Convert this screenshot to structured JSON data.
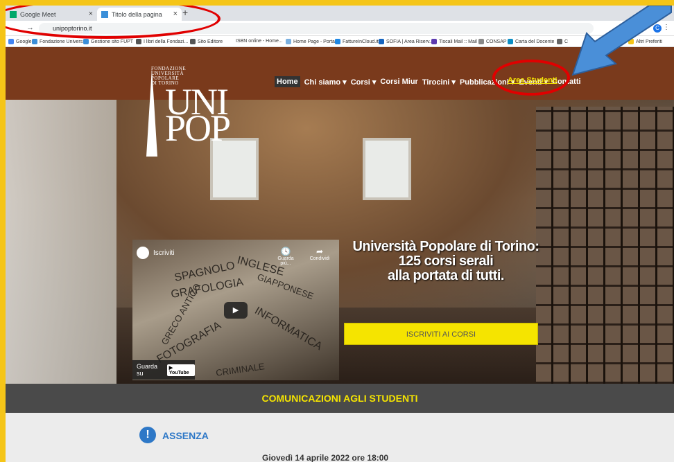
{
  "browser": {
    "tabs": [
      {
        "title": "Google Meet",
        "close": "×"
      },
      {
        "title": "Titolo della pagina",
        "close": "×"
      }
    ],
    "new_tab": "+",
    "window_controls": "—  ☐  ×",
    "nav_arrows": "← → C",
    "url": "unipoptorino.it",
    "profile_initial": "C",
    "bookmarks": [
      "Google",
      "Fondazione Univers...",
      "Gestione sito FUPT",
      "I libri della Fondazi...",
      "Sito Editore",
      "ISBN online - Home...",
      "Home Page - Portal...",
      "FattureInCloud.it",
      "SOFIA | Area Riserv...",
      "Tiscali Mail :: Mail",
      "CONSAP",
      "Carta del Docente",
      "C",
      "»",
      "Altri Preferiti"
    ]
  },
  "site": {
    "logo_lines": [
      "FONDAZIONE",
      "UNIVERSITÀ",
      "POPOLARE",
      "DI TORINO"
    ],
    "logo_big": [
      "UNI",
      "POP"
    ],
    "nav": [
      "Home",
      "Chi siamo ▾",
      "Corsi ▾",
      "Corsi Miur",
      "Tirocini ▾",
      "Pubblicazioni ▾",
      "Eventi ▾",
      "Contatti"
    ],
    "area_studenti": "Area Studenti",
    "video": {
      "channel": "Iscriviti",
      "watch_later": "Guarda più...",
      "share": "Condividi",
      "watch_on": "Guarda su",
      "youtube": "▶ YouTube",
      "play": "▶",
      "words": [
        "SPAGNOLO",
        "INGLESE",
        "GRAFOLOGIA",
        "GIAPPONESE",
        "GRECO ANTICO",
        "FOTOGRAFIA",
        "INFORMATICA",
        "CRIMINALE"
      ]
    },
    "headline": [
      "Università Popolare di Torino:",
      "125 corsi serali",
      "alla portata di tutti."
    ],
    "cta": "ISCRIVITI AI CORSI",
    "comm_title": "COMUNICAZIONI AGLI STUDENTI",
    "assenza_icon": "!",
    "assenza_title": "ASSENZA",
    "assenza_text": "Giovedì 14 aprile 2022 ore 18:00"
  }
}
